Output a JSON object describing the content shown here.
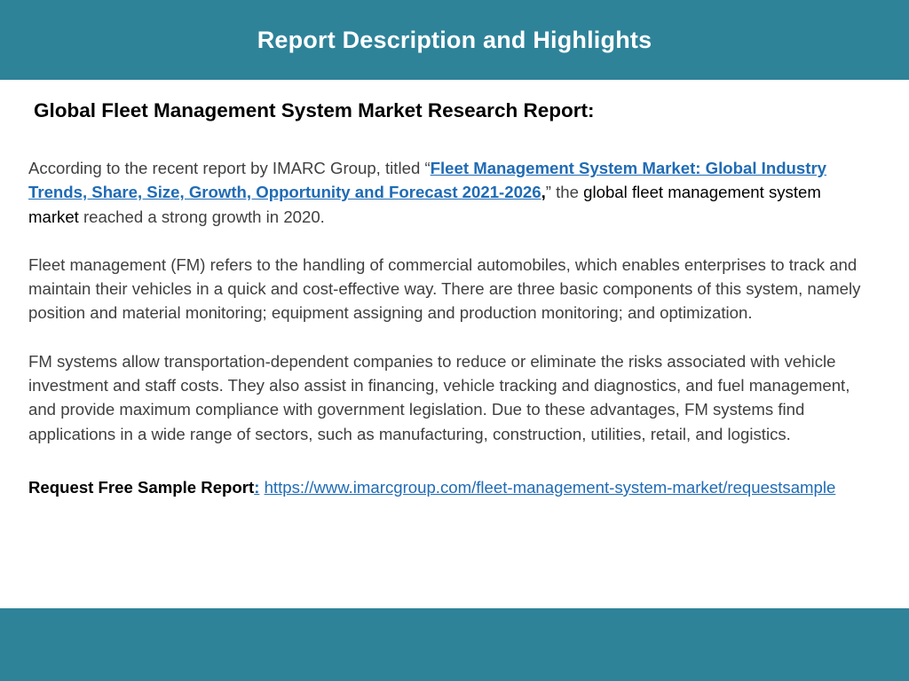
{
  "header": {
    "title": "Report Description and Highlights"
  },
  "main": {
    "heading": "Global Fleet Management System Market Research Report:",
    "intro": {
      "prefix": "According to the recent report by IMARC Group, titled “",
      "link_text": "Fleet Management System Market: Global Industry Trends, Share, Size, Growth, Opportunity and Forecast 2021-2026",
      "comma": ",",
      "close_quote": "” the ",
      "subject": "global fleet management system market",
      "suffix": " reached a strong growth in 2020."
    },
    "paragraph_2": "Fleet management (FM) refers to the handling of commercial automobiles, which enables enterprises to track and maintain their vehicles in a quick and cost-effective way. There are three basic components of this system, namely position and material monitoring; equipment assigning and production monitoring; and optimization.",
    "paragraph_3": "FM systems allow transportation-dependent companies to reduce or eliminate the risks associated with vehicle investment and staff costs. They also assist in financing, vehicle tracking and diagnostics, and fuel management, and provide maximum compliance with government legislation. Due to these advantages, FM systems find applications in a wide range of sectors, such as manufacturing, construction, utilities, retail, and logistics.",
    "sample": {
      "label": "Request Free Sample Report",
      "colon": ":",
      "url": "https://www.imarcgroup.com/fleet-management-system-market/requestsample"
    }
  },
  "colors": {
    "band": "#2e8399",
    "link": "#1f6bb5",
    "body_text": "#404040"
  }
}
